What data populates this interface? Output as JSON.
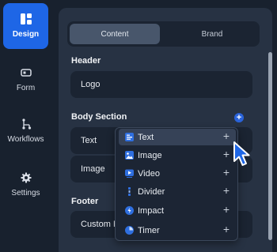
{
  "sidebar": {
    "items": [
      {
        "label": "Design",
        "icon": "layout-icon",
        "active": true
      },
      {
        "label": "Form",
        "icon": "form-icon"
      },
      {
        "label": "Workflows",
        "icon": "workflow-icon"
      },
      {
        "label": "Settings",
        "icon": "gear-icon"
      }
    ]
  },
  "tabs": {
    "content": "Content",
    "brand": "Brand"
  },
  "sections": {
    "header": {
      "title": "Header",
      "fields": [
        "Logo"
      ]
    },
    "body": {
      "title": "Body Section",
      "fields": [
        "Text",
        "Image"
      ]
    },
    "footer": {
      "title": "Footer",
      "fields": [
        "Custom F"
      ]
    }
  },
  "menu": {
    "items": [
      {
        "label": "Text",
        "icon": "text-icon"
      },
      {
        "label": "Image",
        "icon": "image-icon"
      },
      {
        "label": "Video",
        "icon": "video-icon"
      },
      {
        "label": "Divider",
        "icon": "divider-icon"
      },
      {
        "label": "Impact",
        "icon": "impact-icon"
      },
      {
        "label": "Timer",
        "icon": "timer-icon"
      }
    ],
    "plus": "+"
  },
  "colors": {
    "accent": "#1e66e6",
    "panel": "#273243",
    "background": "#18212e",
    "field": "#1b2432"
  }
}
